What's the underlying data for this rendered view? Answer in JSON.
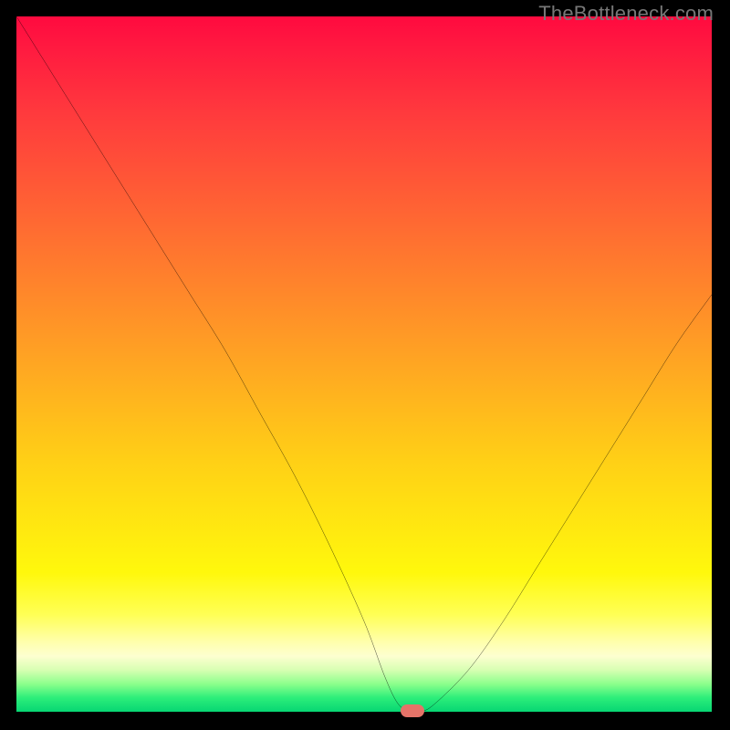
{
  "watermark": "TheBottleneck.com",
  "colors": {
    "frame": "#000000",
    "curve": "#000000",
    "marker": "#e57368"
  },
  "chart_data": {
    "type": "line",
    "title": "",
    "xlabel": "",
    "ylabel": "",
    "xlim": [
      0,
      100
    ],
    "ylim": [
      0,
      100
    ],
    "grid": false,
    "legend": false,
    "annotations": [],
    "series": [
      {
        "name": "bottleneck-curve",
        "x": [
          0,
          5,
          10,
          15,
          20,
          25,
          30,
          35,
          40,
          45,
          50,
          53,
          55,
          57,
          58,
          60,
          65,
          70,
          75,
          80,
          85,
          90,
          95,
          100
        ],
        "y": [
          100,
          92,
          84,
          76,
          68,
          60,
          52,
          43,
          34,
          24,
          13,
          5,
          1,
          0,
          0,
          1,
          6,
          13,
          21,
          29,
          37,
          45,
          53,
          60
        ]
      }
    ],
    "marker": {
      "x": 57,
      "y": 0
    }
  }
}
